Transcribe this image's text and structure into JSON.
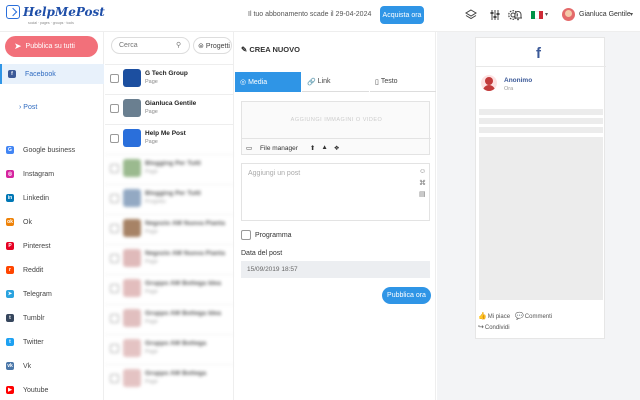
{
  "app": {
    "logo_text": "HelpMePost",
    "logo_sub": "social · pages · groups · tools"
  },
  "header": {
    "subscription_msg": "Il tuo abbonamento scade il 29-04-2024",
    "buy_label": "Acquista ora",
    "language_code": "it",
    "user_name": "Gianluca Gentile",
    "icons": [
      "layers-icon",
      "sliders-icon",
      "gear-icon",
      "bell-icon"
    ]
  },
  "sidebar": {
    "publish_all_label": "Pubblica su tutti",
    "items": [
      {
        "label": "Facebook",
        "icon": "facebook-icon",
        "color": "#3b5998",
        "glyph": "f"
      },
      {
        "label": "Google business",
        "icon": "google-business-icon",
        "color": "#4285f4",
        "glyph": "G"
      },
      {
        "label": "Instagram",
        "icon": "instagram-icon",
        "color": "#d6249f",
        "glyph": "◎"
      },
      {
        "label": "Linkedin",
        "icon": "linkedin-icon",
        "color": "#0077b5",
        "glyph": "in"
      },
      {
        "label": "Ok",
        "icon": "ok-icon",
        "color": "#ee8208",
        "glyph": "ok"
      },
      {
        "label": "Pinterest",
        "icon": "pinterest-icon",
        "color": "#e60023",
        "glyph": "P"
      },
      {
        "label": "Reddit",
        "icon": "reddit-icon",
        "color": "#ff4500",
        "glyph": "r"
      },
      {
        "label": "Telegram",
        "icon": "telegram-icon",
        "color": "#2aa3df",
        "glyph": "➤"
      },
      {
        "label": "Tumblr",
        "icon": "tumblr-icon",
        "color": "#36465d",
        "glyph": "t"
      },
      {
        "label": "Twitter",
        "icon": "twitter-icon",
        "color": "#1da1f2",
        "glyph": "t"
      },
      {
        "label": "Vk",
        "icon": "vk-icon",
        "color": "#4a76a8",
        "glyph": "vk"
      },
      {
        "label": "Youtube",
        "icon": "youtube-icon",
        "color": "#ff0000",
        "glyph": "▶"
      }
    ],
    "sub_item": "Post"
  },
  "pages": {
    "search_placeholder": "Cerca",
    "projects_label": "Progetti",
    "rows": [
      {
        "name": "G Tech Group",
        "type": "Page",
        "thumb": "#1c4fa0"
      },
      {
        "name": "Gianluca Gentile",
        "type": "Page",
        "thumb": "#6a7f90"
      },
      {
        "name": "Help Me Post",
        "type": "Page",
        "thumb": "#2a6fdb"
      },
      {
        "name": "Blogging Per Tutti",
        "type": "Page",
        "thumb": "#7aa36a"
      },
      {
        "name": "Blogging Per Tutti",
        "type": "Progetto",
        "thumb": "#6f8db0"
      },
      {
        "name": "Negozio AM Nuova Pianta",
        "type": "Page",
        "thumb": "#8a5a33"
      },
      {
        "name": "Negozio AM Nuova Pianta",
        "type": "Page",
        "thumb": "#d5a3a3"
      },
      {
        "name": "Gruppo AM Bottega Idea",
        "type": "Page",
        "thumb": "#d9a8a8"
      },
      {
        "name": "Gruppo AM Bottega Idea",
        "type": "Page",
        "thumb": "#d7aaaa"
      },
      {
        "name": "Gruppo AM Bottega",
        "type": "Page",
        "thumb": "#dcb0b0"
      },
      {
        "name": "Gruppo AM Bottega",
        "type": "Page",
        "thumb": "#dcb0b0"
      }
    ]
  },
  "composer": {
    "title": "CREA NUOVO",
    "tabs": [
      "Media",
      "Link",
      "Testo"
    ],
    "media_drop_text": "AGGIUNGI IMMAGINI O VIDEO",
    "file_manager_label": "File manager",
    "post_placeholder": "Aggiungi un post",
    "schedule_label": "Programma",
    "date_label": "Data del post",
    "date_value": "15/09/2019 18:57",
    "publish_label": "Pubblica ora"
  },
  "preview": {
    "network_glyph": "f",
    "author": "Anonimo",
    "time": "Ora",
    "like_label": "Mi piace",
    "comment_label": "Commenti",
    "share_label": "Condividi"
  }
}
